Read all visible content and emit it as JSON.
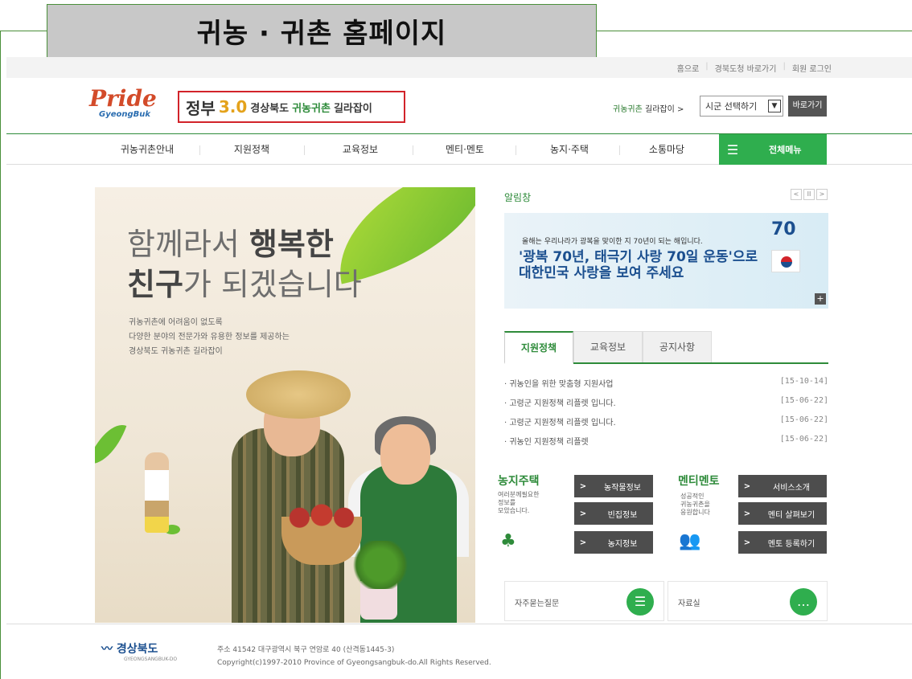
{
  "slide_title": "귀농 · 귀촌 홈페이지",
  "top_links": [
    "홈으로",
    "경북도청 바로가기",
    "회원 로그인"
  ],
  "logo": {
    "main": "Pride",
    "sub": "GyeongBuk"
  },
  "gov_banner": {
    "gov": "정부",
    "gov_num": "3.0",
    "region": "경상북도",
    "title_green": "귀농귀촌",
    "title_rest": "길라잡이"
  },
  "quick_nav": {
    "label_green": "귀농귀촌",
    "label_rest": "길라잡이 >",
    "select_value": "시군 선택하기",
    "go_button": "바로가기"
  },
  "nav": [
    "귀농귀촌안내",
    "지원정책",
    "교육정보",
    "멘티·멘토",
    "농지·주택",
    "소통마당"
  ],
  "all_menu": "전체메뉴",
  "hero": {
    "line1_light": "함께라서 ",
    "line1_bold": "행복한",
    "line2_bold": "친구",
    "line2_light": "가 되겠습니다",
    "sub": [
      "귀농귀촌에 어려움이 없도록",
      "다양한 분야의 전문가와 유용한 정보를 제공하는",
      "경상북도 귀농귀촌 길라잡이"
    ]
  },
  "notice": {
    "title": "알림창",
    "pager": [
      "<",
      "II",
      ">"
    ],
    "banner_small": "올해는 우리나라가 광복을 맞이한 지 70년이 되는 해입니다.",
    "banner_big1": "'광복 70년, 태극기 사랑 70일 운동'으로",
    "banner_big2": "대한민국 사랑을 보여 주세요",
    "banner_num": "70",
    "plus": "+"
  },
  "tabs": [
    "지원정책",
    "교육정보",
    "공지사항"
  ],
  "news": [
    {
      "title": "· 귀농인을 위한 맞춤형 지원사업",
      "date": "[15-10-14]"
    },
    {
      "title": "· 고령군 지원정책 리플렛 입니다.",
      "date": "[15-06-22]"
    },
    {
      "title": "· 고령군 지원정책 리플렛 입니다.",
      "date": "[15-06-22]"
    },
    {
      "title": "· 귀농인 지원정책 리플렛",
      "date": "[15-06-22]"
    }
  ],
  "farm": {
    "title": "농지주택",
    "sub": [
      "여러분께필요한",
      "정보를",
      "모았습니다."
    ],
    "buttons": [
      "농작물정보",
      "빈집정보",
      "농지정보"
    ]
  },
  "mentor": {
    "title": "멘티멘토",
    "sub": [
      "성공적인",
      "귀농귀촌을",
      "응원합니다"
    ],
    "buttons": [
      "서비스소개",
      "멘티 살펴보기",
      "멘토 등록하기"
    ]
  },
  "bottom": {
    "faq": "자주묻는질문",
    "archive": "자료실"
  },
  "footer": {
    "logo": "경상북도",
    "logo_sub": "GYEONGSANGBUK-DO",
    "address": "주소 41542 대구광역시 북구 연암로 40 (산격동1445-3)",
    "copyright": "Copyright(c)1997-2010 Province of Gyeongsangbuk-do.All Rights Reserved."
  },
  "colors": {
    "brand_green": "#2e8b3a",
    "menu_green": "#2fae4e",
    "gov_box_red": "#d2232a"
  }
}
